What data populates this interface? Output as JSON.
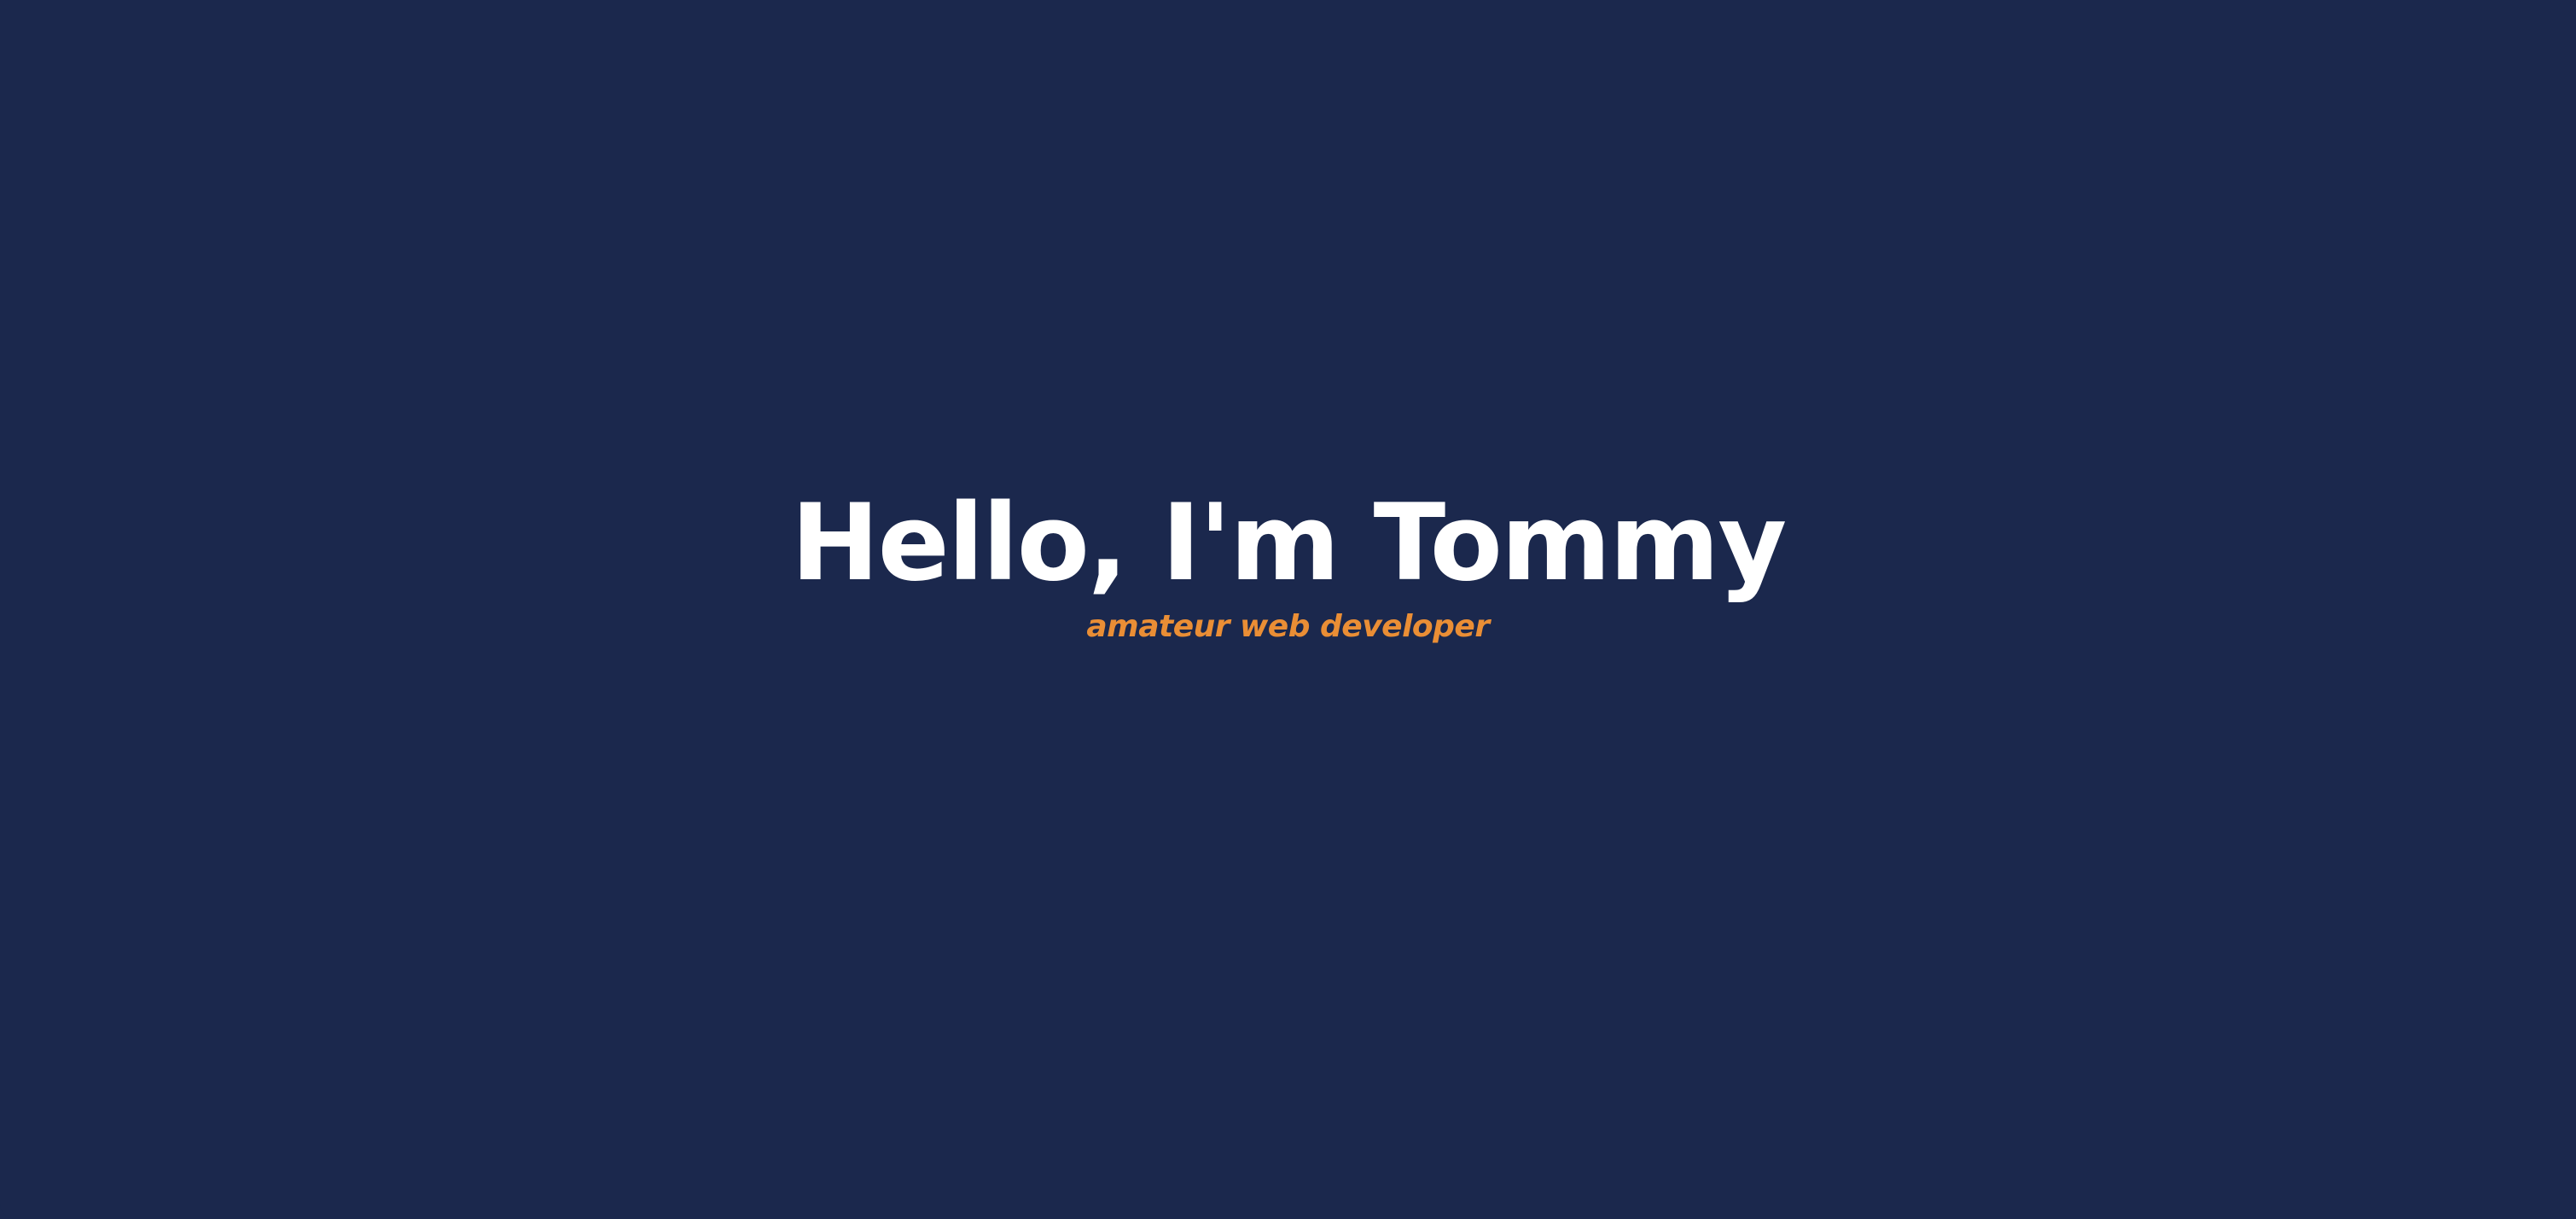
{
  "hero": {
    "title": "Hello, I'm Tommy",
    "subtitle": "amateur web developer"
  },
  "colors": {
    "background": "#1b284d",
    "title": "#ffffff",
    "accent": "#ea8e35"
  }
}
